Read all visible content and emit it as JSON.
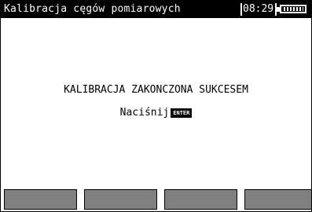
{
  "header": {
    "title": "Kalibracja cęgów pomiarowych",
    "time": "08:29"
  },
  "icons": {
    "battery": "battery-icon",
    "enter": "enter-key-icon"
  },
  "main": {
    "message": "KALIBRACJA ZAKONCZONA SUKCESEM",
    "prompt": "Naciśnij",
    "enter_label": "ENTER"
  },
  "softkeys": [
    "",
    "",
    "",
    ""
  ],
  "colors": {
    "titlebar_bg": "#000000",
    "titlebar_fg": "#ffffff",
    "softkey": "#808080",
    "screen_bg": "#ffffff"
  }
}
